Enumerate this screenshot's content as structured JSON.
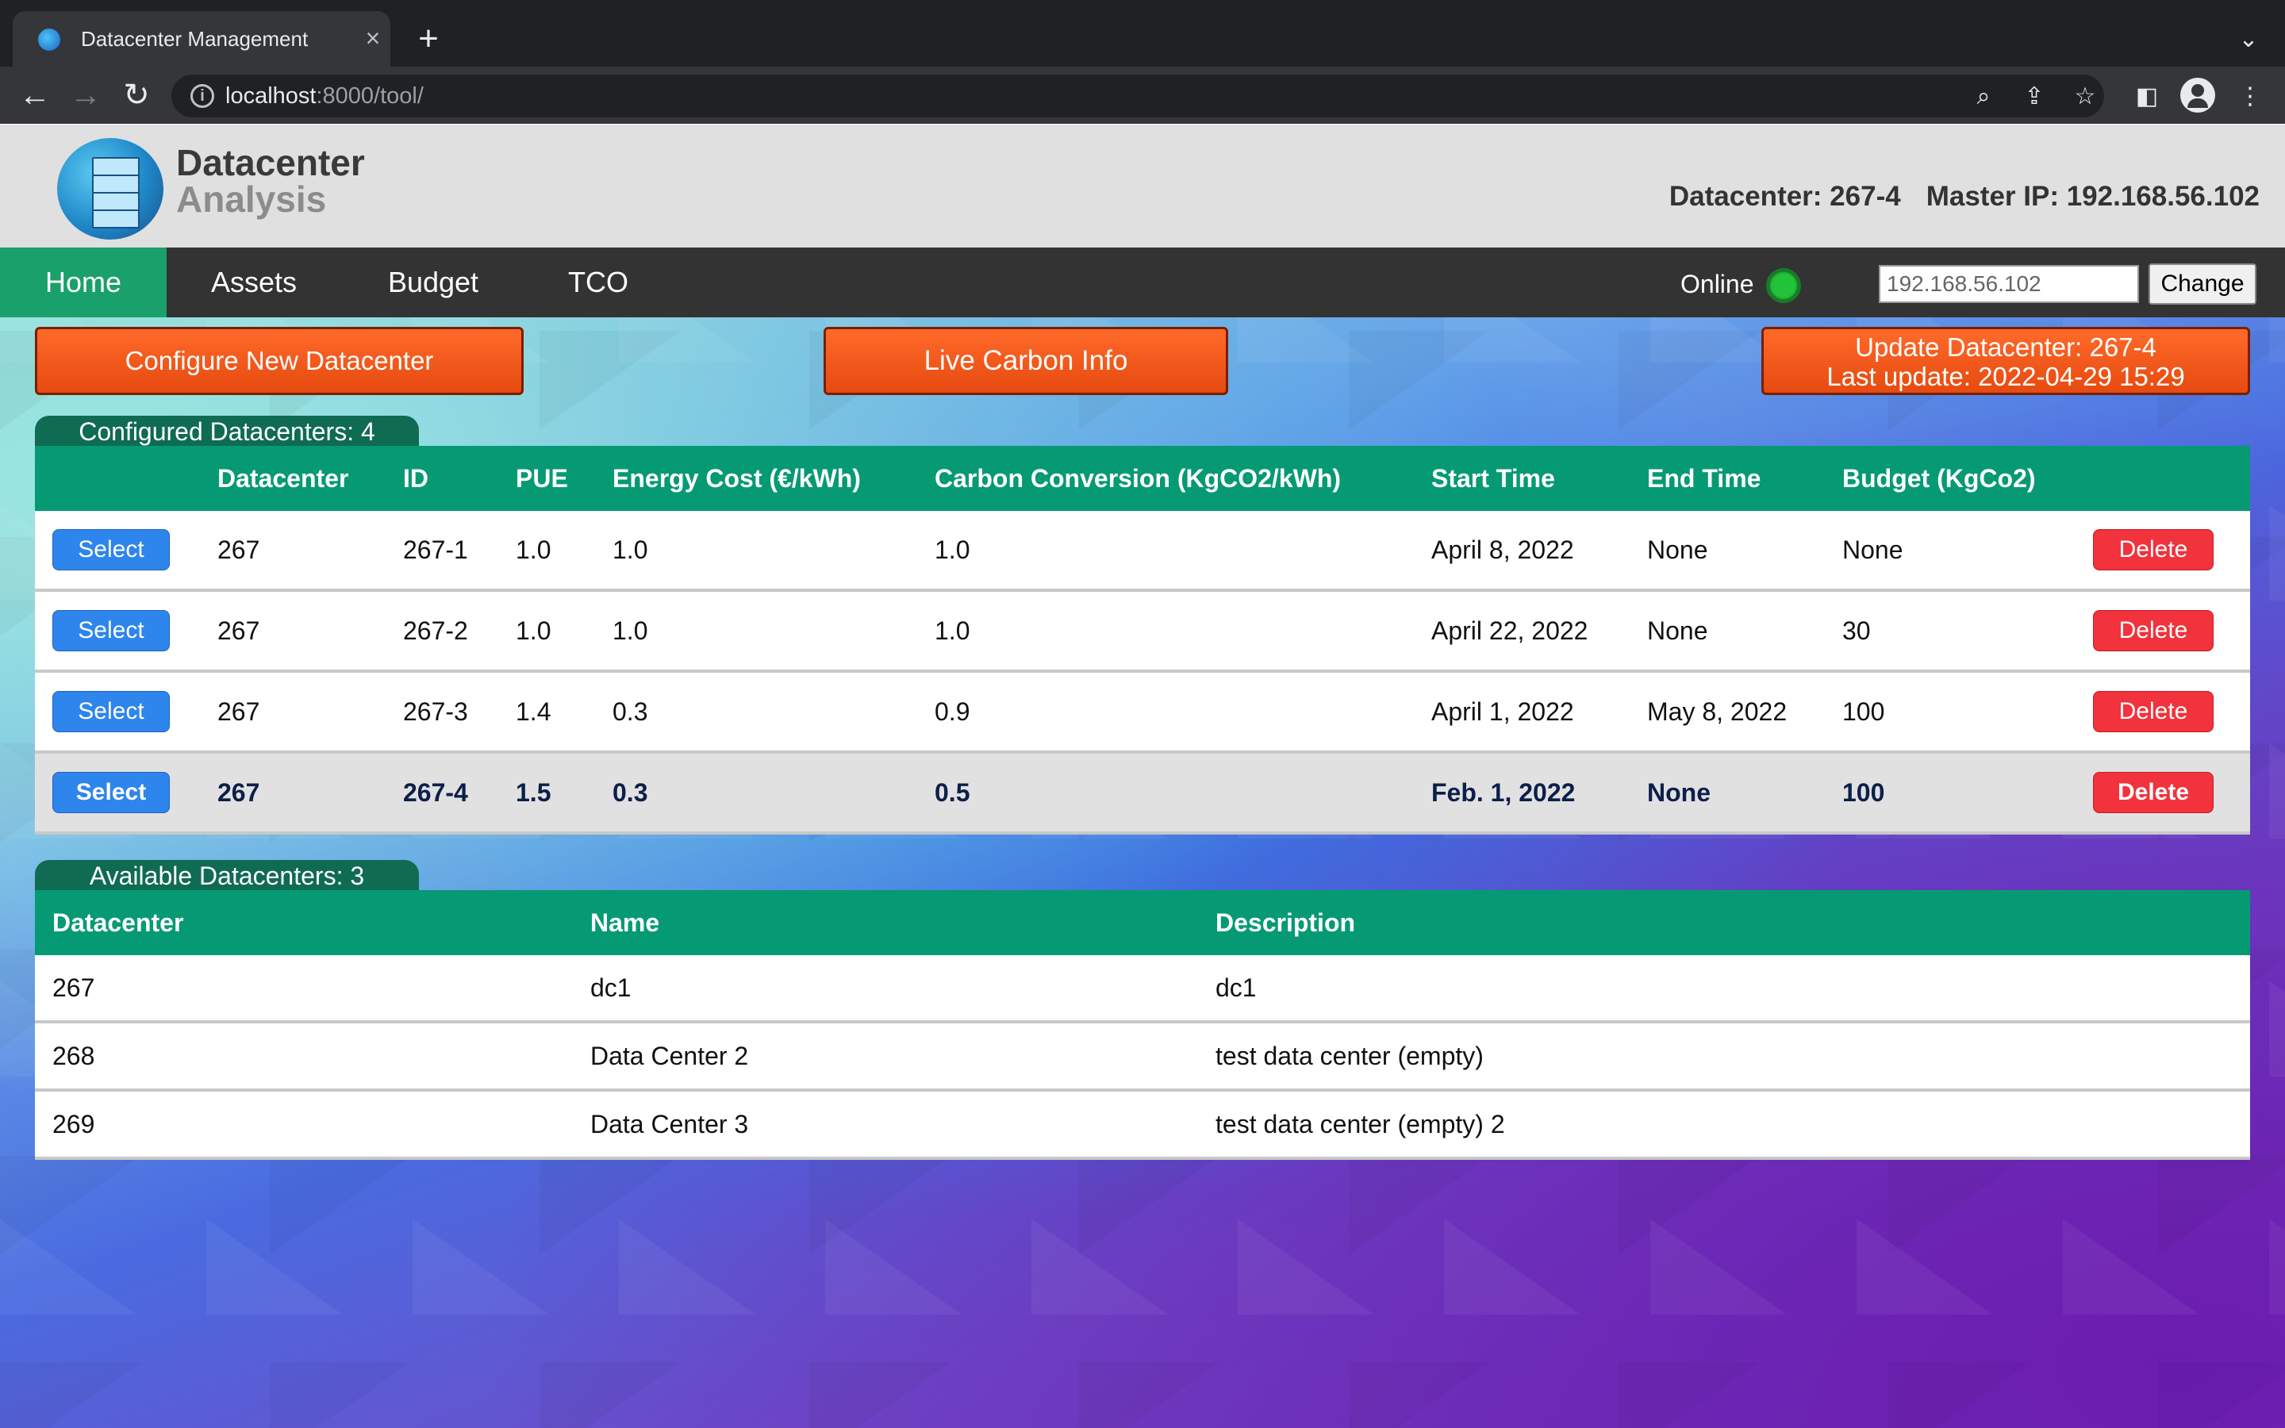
{
  "browser": {
    "tab_title": "Datacenter Management",
    "url_host": "localhost",
    "url_rest": ":8000/tool/"
  },
  "header": {
    "logo_line1": "Datacenter",
    "logo_line2": "Analysis",
    "datacenter_info": "Datacenter: 267-4",
    "master_ip_info": "Master IP: 192.168.56.102"
  },
  "nav": {
    "items": [
      {
        "label": "Home",
        "active": true
      },
      {
        "label": "Assets"
      },
      {
        "label": "Budget"
      },
      {
        "label": "TCO"
      }
    ],
    "online_label": "Online",
    "online_color": "#22c33a",
    "ip_value": "192.168.56.102",
    "change_label": "Change"
  },
  "actions": {
    "configure_label": "Configure New Datacenter",
    "carbon_label": "Live Carbon Info",
    "update_line1": "Update Datacenter: 267-4",
    "update_line2": "Last update: 2022-04-29 15:29"
  },
  "configured": {
    "label": "Configured Datacenters: 4",
    "columns": [
      "",
      "Datacenter",
      "ID",
      "PUE",
      "Energy Cost (€/kWh)",
      "Carbon Conversion (KgCO2/kWh)",
      "Start Time",
      "End Time",
      "Budget (KgCo2)",
      ""
    ],
    "select_label": "Select",
    "delete_label": "Delete",
    "rows": [
      {
        "datacenter": "267",
        "id": "267-1",
        "pue": "1.0",
        "energy_cost": "1.0",
        "carbon": "1.0",
        "start": "April 8, 2022",
        "end": "None",
        "budget": "None"
      },
      {
        "datacenter": "267",
        "id": "267-2",
        "pue": "1.0",
        "energy_cost": "1.0",
        "carbon": "1.0",
        "start": "April 22, 2022",
        "end": "None",
        "budget": "30"
      },
      {
        "datacenter": "267",
        "id": "267-3",
        "pue": "1.4",
        "energy_cost": "0.3",
        "carbon": "0.9",
        "start": "April 1, 2022",
        "end": "May 8, 2022",
        "budget": "100"
      },
      {
        "datacenter": "267",
        "id": "267-4",
        "pue": "1.5",
        "energy_cost": "0.3",
        "carbon": "0.5",
        "start": "Feb. 1, 2022",
        "end": "None",
        "budget": "100",
        "active": true
      }
    ]
  },
  "available": {
    "label": "Available Datacenters: 3",
    "columns": [
      "Datacenter",
      "Name",
      "Description"
    ],
    "rows": [
      {
        "datacenter": "267",
        "name": "dc1",
        "description": "dc1"
      },
      {
        "datacenter": "268",
        "name": "Data Center 2",
        "description": "test data center (empty)"
      },
      {
        "datacenter": "269",
        "name": "Data Center 3",
        "description": "test data center (empty) 2"
      }
    ]
  },
  "colors": {
    "accent_green": "#069a74",
    "nav_active": "#1aa06b",
    "orange": "#ff6a2a",
    "select_blue": "#2e85ec",
    "delete_red": "#f2323c"
  }
}
